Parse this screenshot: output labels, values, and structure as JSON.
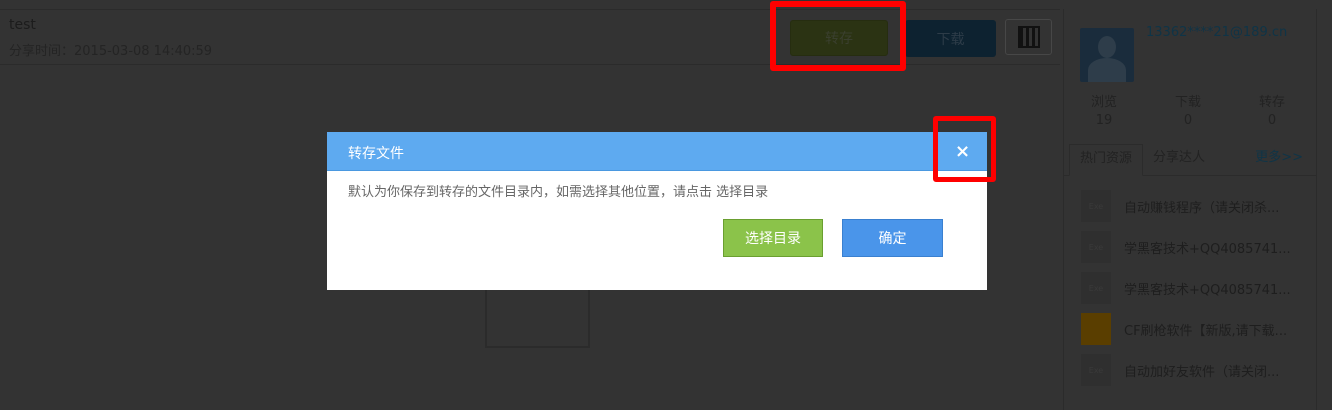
{
  "file": {
    "title": "test",
    "share_time": "分享时间：2015-03-08 14:40:59"
  },
  "toolbar": {
    "save_label": "转存",
    "download_label": "下载",
    "qr_icon": "qr-code-icon"
  },
  "user": {
    "email": "13362****21@189.cn",
    "stats": [
      {
        "label": "浏览",
        "value": "19"
      },
      {
        "label": "下载",
        "value": "0"
      },
      {
        "label": "转存",
        "value": "0"
      }
    ]
  },
  "tabs": {
    "hot": "热门资源",
    "sharers": "分享达人",
    "more": "更多>>"
  },
  "resources": [
    {
      "icon": "Exe",
      "name": "自动赚钱程序（请关闭杀..."
    },
    {
      "icon": "Exe",
      "name": "学黑客技术+QQ4085741..."
    },
    {
      "icon": "Exe",
      "name": "学黑客技术+QQ4085741..."
    },
    {
      "icon": "zip",
      "name": "CF刷枪软件【新版,请下载..."
    },
    {
      "icon": "Exe",
      "name": "自动加好友软件（请关闭..."
    }
  ],
  "dialog": {
    "title": "转存文件",
    "close": "×",
    "message": "默认为你保存到转存的文件目录内，如需选择其他位置，请点击 选择目录",
    "choose_label": "选择目录",
    "confirm_label": "确定"
  },
  "colors": {
    "dialog_header": "#5eaaf0",
    "choose": "#8bc34a",
    "confirm": "#4a95ea",
    "highlight": "#ff0000"
  }
}
